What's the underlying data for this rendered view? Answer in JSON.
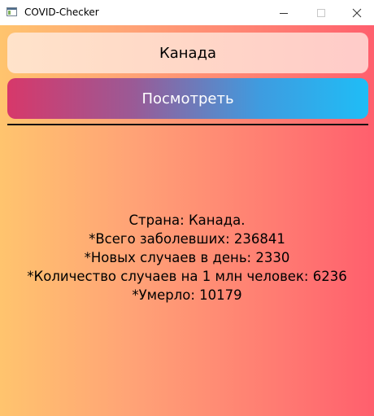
{
  "window": {
    "title": "COVID-Checker",
    "icons": {
      "app": "window-app-icon",
      "minimize": "minimize-icon",
      "maximize": "maximize-icon",
      "close": "close-icon"
    }
  },
  "form": {
    "country_value": "Канада",
    "check_button_label": "Посмотреть"
  },
  "stats": {
    "country_line": "Страна: Канада.",
    "total_cases_line": "*Всего заболевших: 236841",
    "new_cases_line": "*Новых случаев в день: 2330",
    "per_million_line": "*Количество случаев на 1 млн человек: 6236",
    "deaths_line": "*Умерло: 10179"
  },
  "colors": {
    "background_left": "#ffc46e",
    "background_right": "#ff5f6d",
    "button_left": "#d7386a",
    "button_right": "#1fbdf6"
  }
}
